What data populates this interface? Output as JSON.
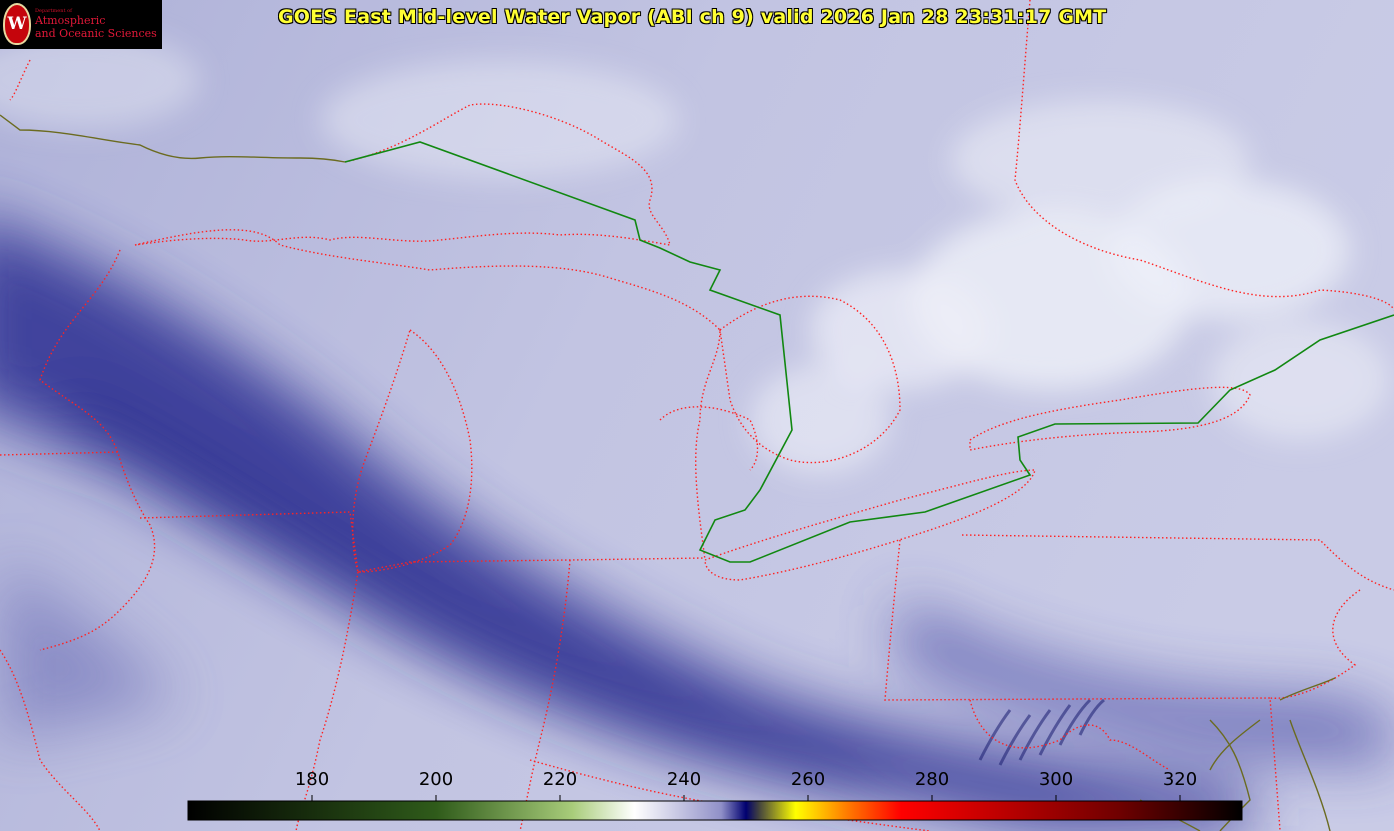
{
  "title": "GOES East Mid-level Water Vapor (ABI ch 9)  valid 2026 Jan 28 23:31:17 GMT",
  "logo": {
    "letter": "W",
    "department_line": "Department of",
    "line1": "Atmospheric",
    "line2": "and Oceanic Sciences"
  },
  "colorbar": {
    "min": 160,
    "max": 330,
    "ticks": [
      180,
      200,
      220,
      240,
      260,
      280,
      300,
      320
    ],
    "tick_labels": [
      "180",
      "200",
      "220",
      "240",
      "260",
      "280",
      "300",
      "320"
    ],
    "stops": [
      {
        "v": 160,
        "c": "#000000"
      },
      {
        "v": 200,
        "c": "#2f5b1a"
      },
      {
        "v": 222,
        "c": "#a8cc7a"
      },
      {
        "v": 232,
        "c": "#ffffff"
      },
      {
        "v": 246,
        "c": "#9090c8"
      },
      {
        "v": 250,
        "c": "#000070"
      },
      {
        "v": 252,
        "c": "#404040"
      },
      {
        "v": 258,
        "c": "#ffff00"
      },
      {
        "v": 266,
        "c": "#ff8000"
      },
      {
        "v": 275,
        "c": "#ff0000"
      },
      {
        "v": 310,
        "c": "#700000"
      },
      {
        "v": 330,
        "c": "#000000"
      }
    ]
  },
  "colors": {
    "state_borders": "#ff2222",
    "intl_border": "#118811",
    "coastline": "#6b6b20",
    "title_text": "#ffff33",
    "moist": "#e8e9f4",
    "dry": "#25288a"
  }
}
